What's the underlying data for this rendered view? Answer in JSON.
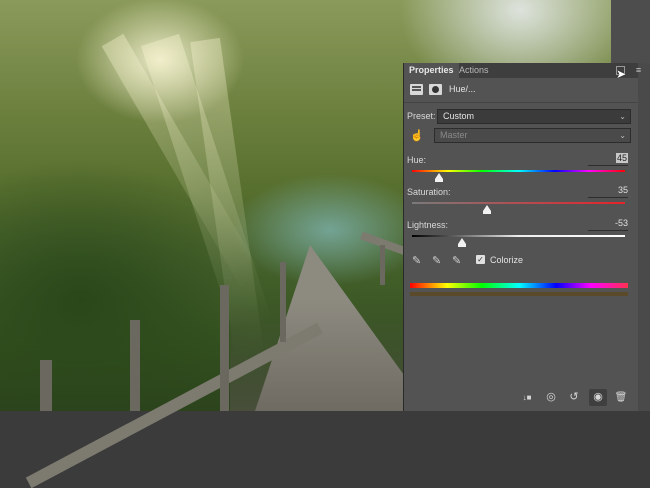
{
  "panel": {
    "tabs": [
      {
        "label": "Properties",
        "active": true
      },
      {
        "label": "Actions",
        "active": false
      }
    ],
    "title": "Hue/...",
    "preset": {
      "label": "Preset:",
      "value": "Custom"
    },
    "channel": {
      "value": "Master"
    },
    "hue": {
      "label": "Hue:",
      "value": "45",
      "fraction": 0.125
    },
    "saturation": {
      "label": "Saturation:",
      "value": "35",
      "fraction": 0.35
    },
    "lightness": {
      "label": "Lightness:",
      "value": "-53",
      "fraction": 0.235
    },
    "colorize": {
      "label": "Colorize",
      "checked": true
    }
  },
  "icons": {
    "menu": "≡",
    "chevron": "⌄",
    "check": "✓",
    "hand": "☝",
    "dropper": "✎",
    "clip": "↓■",
    "eye_prev": "◎",
    "reset": "↺",
    "eye": "◉",
    "trash": "🗑",
    "cursor": "➤"
  },
  "colors": {
    "panel_bg": "#535353",
    "result_bar": "#5a4a2a"
  }
}
